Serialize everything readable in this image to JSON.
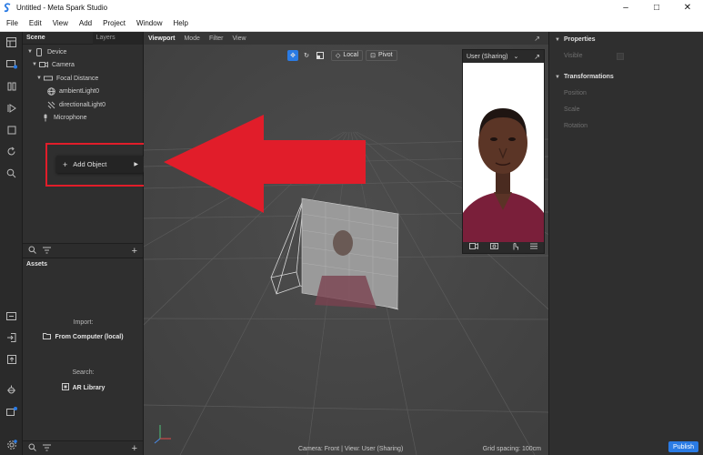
{
  "window": {
    "title": "Untitled - Meta Spark Studio"
  },
  "menu": [
    "File",
    "Edit",
    "View",
    "Add",
    "Project",
    "Window",
    "Help"
  ],
  "scene": {
    "tabs": {
      "scene": "Scene",
      "layers": "Layers"
    },
    "tree": [
      {
        "label": "Device",
        "icon": "device-icon"
      },
      {
        "label": "Camera",
        "icon": "camera-icon"
      },
      {
        "label": "Focal Distance",
        "icon": "focal-distance-icon"
      },
      {
        "label": "ambientLight0",
        "icon": "ambient-light-icon"
      },
      {
        "label": "directionalLight0",
        "icon": "directional-light-icon"
      },
      {
        "label": "Microphone",
        "icon": "microphone-icon"
      }
    ],
    "context_menu": {
      "add_object": "Add Object"
    }
  },
  "assets": {
    "title": "Assets",
    "import_label": "Import:",
    "from_computer": "From Computer (local)",
    "search_label": "Search:",
    "ar_library": "AR Library"
  },
  "viewport": {
    "tabs": [
      "Viewport",
      "Mode",
      "Filter",
      "View"
    ],
    "tools": {
      "local": "Local",
      "pivot": "Pivot"
    },
    "status_camera": "Camera: Front | View: User (Sharing)",
    "grid_spacing": "Grid spacing: 100cm"
  },
  "simulator": {
    "device_label": "User (Sharing)"
  },
  "properties": {
    "title": "Properties",
    "visible_label": "Visible",
    "transformations": "Transformations",
    "position": "Position",
    "scale": "Scale",
    "rotation": "Rotation"
  },
  "publish_label": "Publish",
  "colors": {
    "accent": "#2a7be4",
    "highlight": "#e11d2a"
  }
}
